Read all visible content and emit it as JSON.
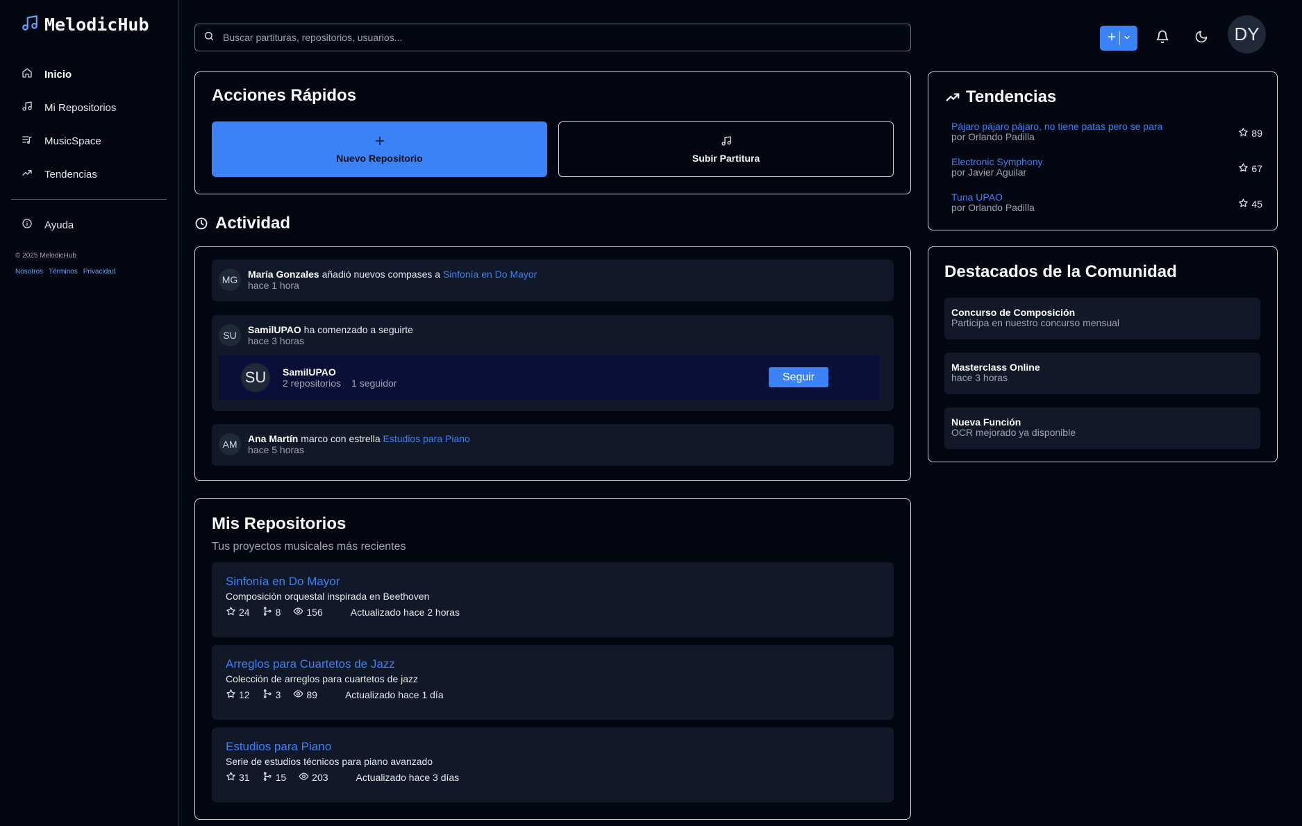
{
  "brand": {
    "name": "MelodicHub"
  },
  "sidebar": {
    "items": [
      {
        "label": "Inicio",
        "icon": "home-icon"
      },
      {
        "label": "Mi Repositorios",
        "icon": "music-note-icon"
      },
      {
        "label": "MusicSpace",
        "icon": "playlist-icon"
      },
      {
        "label": "Tendencias",
        "icon": "trending-icon"
      }
    ],
    "help": {
      "label": "Ayuda",
      "icon": "info-icon"
    }
  },
  "footer": {
    "copyright": "© 2025 MelodicHub",
    "links": [
      "Nosotros",
      "Términos",
      "Privacidad"
    ]
  },
  "search": {
    "placeholder": "Buscar partituras, repositorios, usuarios..."
  },
  "user": {
    "initials": "DY"
  },
  "quick_actions": {
    "title": "Acciones Rápidos",
    "new_repo": "Nuevo Repositorio",
    "upload": "Subir Partitura"
  },
  "activity": {
    "title": "Actividad",
    "items": [
      {
        "initials": "MG",
        "user": "María Gonzales",
        "action": " añadió nuevos compases a ",
        "target": "Sinfonía en Do Mayor",
        "time": "hace 1 hora"
      },
      {
        "initials": "SU",
        "user": "SamilUPAO",
        "action": " ha comenzado a seguirte",
        "time": "hace 3 horas",
        "card": {
          "initials": "SU",
          "name": "SamilUPAO",
          "repos": "2 repositorios",
          "followers": "1 seguidor",
          "button": "Seguir"
        }
      },
      {
        "initials": "AM",
        "user": "Ana Martín",
        "action": " marco con estrella ",
        "target": "Estudios para Piano",
        "time": "hace 5 horas"
      }
    ]
  },
  "repos": {
    "title": "Mis Repositorios",
    "subtitle": "Tus proyectos musicales más recientes",
    "items": [
      {
        "name": "Sinfonía en Do Mayor",
        "desc": "Composición orquestal inspirada en Beethoven",
        "stars": "24",
        "forks": "8",
        "views": "156",
        "updated": "Actualizado hace 2 horas"
      },
      {
        "name": "Arreglos para Cuartetos de Jazz",
        "desc": "Colección de arreglos para cuartetos de jazz",
        "stars": "12",
        "forks": "3",
        "views": "89",
        "updated": "Actualizado hace 1 día"
      },
      {
        "name": "Estudios para Piano",
        "desc": "Serie de estudios técnicos para piano avanzado",
        "stars": "31",
        "forks": "15",
        "views": "203",
        "updated": "Actualizado hace 3 días"
      }
    ]
  },
  "trends": {
    "title": "Tendencias",
    "items": [
      {
        "name": "Pájaro pájaro pájaro, no tiene patas pero se para",
        "by": "por Orlando Padilla",
        "stars": "89"
      },
      {
        "name": "Electronic Symphony",
        "by": "por Javier Aguilar",
        "stars": "67"
      },
      {
        "name": "Tuna UPAO",
        "by": "por Orlando Padilla",
        "stars": "45"
      }
    ]
  },
  "featured": {
    "title": "Destacados de la Comunidad",
    "items": [
      {
        "title": "Concurso de Composición",
        "sub": "Participa en nuestro concurso mensual"
      },
      {
        "title": "Masterclass Online",
        "sub": "hace 3 horas"
      },
      {
        "title": "Nueva Función",
        "sub": "OCR mejorado ya disponible"
      }
    ]
  },
  "colors": {
    "accent": "#3b82f6",
    "background": "#030712",
    "panel": "#111827"
  }
}
